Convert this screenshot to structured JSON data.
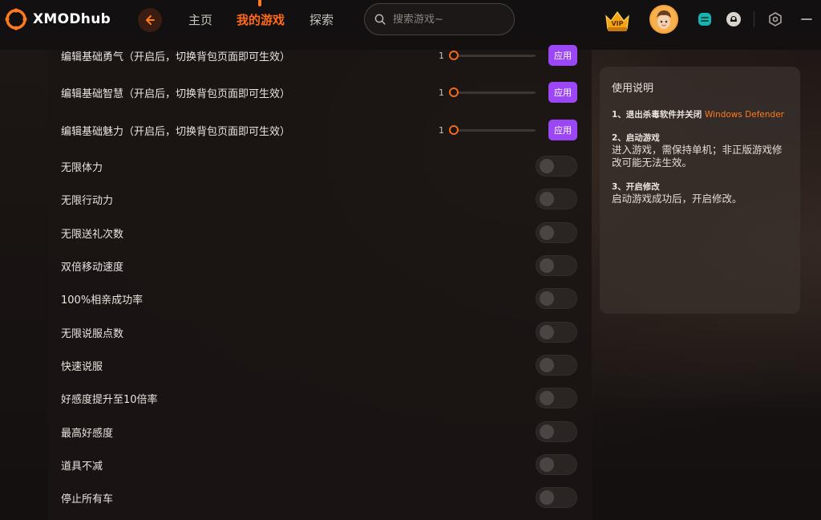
{
  "app": {
    "logo_text": "XMODhub"
  },
  "nav": {
    "items": [
      {
        "label": "主页"
      },
      {
        "label": "我的游戏"
      },
      {
        "label": "探索"
      }
    ],
    "active_index": 1
  },
  "search": {
    "placeholder": "搜索游戏~"
  },
  "topbar": {
    "vip_label": "VIP"
  },
  "sliders": [
    {
      "label": "编辑基础勇气（开启后，切换背包页面即可生效）",
      "value": "1",
      "apply_label": "应用"
    },
    {
      "label": "编辑基础智慧（开启后，切换背包页面即可生效）",
      "value": "1",
      "apply_label": "应用"
    },
    {
      "label": "编辑基础魅力（开启后，切换背包页面即可生效）",
      "value": "1",
      "apply_label": "应用"
    }
  ],
  "toggles": [
    {
      "label": "无限体力",
      "on": false
    },
    {
      "label": "无限行动力",
      "on": false
    },
    {
      "label": "无限送礼次数",
      "on": false
    },
    {
      "label": "双倍移动速度",
      "on": false
    },
    {
      "label": "100%相亲成功率",
      "on": false
    },
    {
      "label": "无限说服点数",
      "on": false
    },
    {
      "label": "快速说服",
      "on": false
    },
    {
      "label": "好感度提升至10倍率",
      "on": false
    },
    {
      "label": "最高好感度",
      "on": false
    },
    {
      "label": "道具不减",
      "on": false
    },
    {
      "label": "停止所有车",
      "on": false
    }
  ],
  "instructions": {
    "title": "使用说明",
    "steps": [
      {
        "title": "1、退出杀毒软件并关闭",
        "highlight": "Windows Defender",
        "body": ""
      },
      {
        "title": "2、启动游戏",
        "highlight": "",
        "body": "进入游戏，需保持单机；非正版游戏修改可能无法生效。"
      },
      {
        "title": "3、开启修改",
        "highlight": "",
        "body": "启动游戏成功后，开启修改。"
      }
    ]
  },
  "colors": {
    "accent": "#ff6a1a",
    "apply_button": "#9b47f5",
    "background": "#151010"
  }
}
